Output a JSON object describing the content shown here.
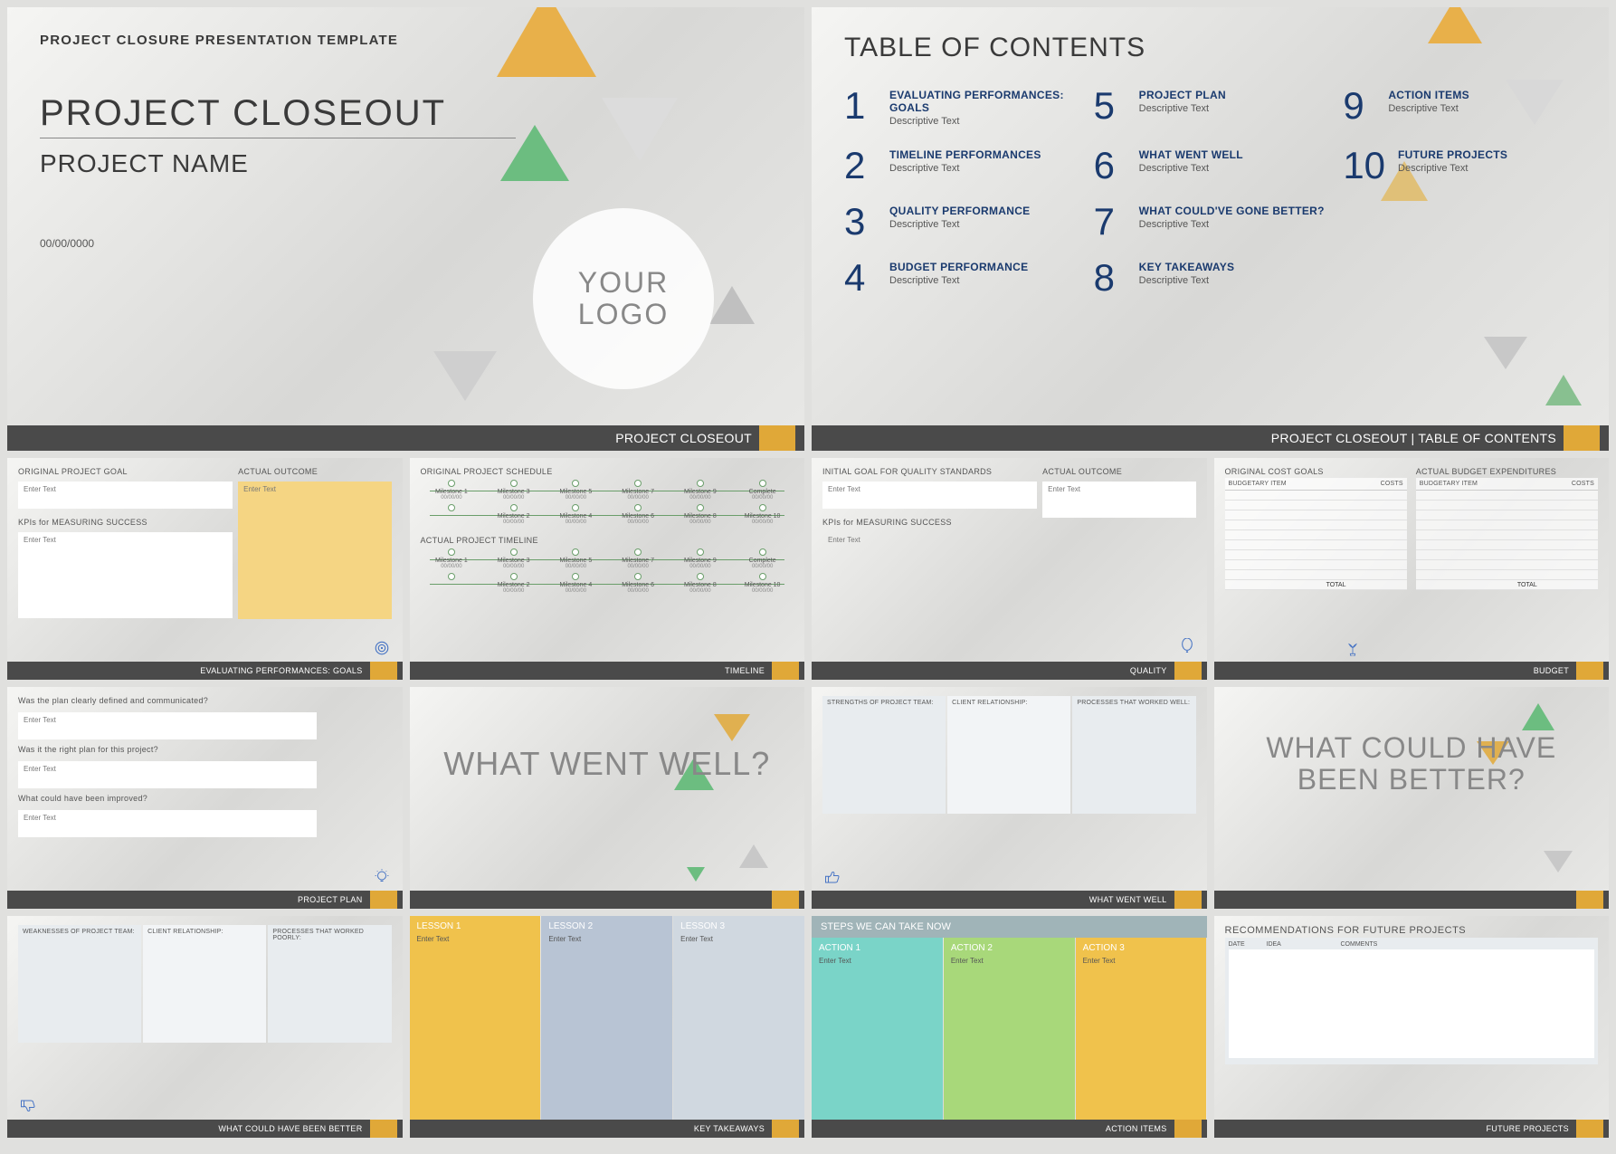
{
  "s1": {
    "header": "PROJECT CLOSURE PRESENTATION TEMPLATE",
    "title": "PROJECT CLOSEOUT",
    "subtitle": "PROJECT NAME",
    "date": "00/00/0000",
    "logo": "YOUR LOGO",
    "footer": "PROJECT CLOSEOUT"
  },
  "s2": {
    "title": "TABLE OF CONTENTS",
    "items": [
      {
        "n": "1",
        "t": "EVALUATING PERFORMANCES: GOALS",
        "d": "Descriptive Text"
      },
      {
        "n": "5",
        "t": "PROJECT PLAN",
        "d": "Descriptive Text"
      },
      {
        "n": "9",
        "t": "ACTION ITEMS",
        "d": "Descriptive Text"
      },
      {
        "n": "2",
        "t": "TIMELINE PERFORMANCES",
        "d": "Descriptive Text"
      },
      {
        "n": "6",
        "t": "WHAT WENT WELL",
        "d": "Descriptive Text"
      },
      {
        "n": "10",
        "t": "FUTURE PROJECTS",
        "d": "Descriptive Text"
      },
      {
        "n": "3",
        "t": "QUALITY PERFORMANCE",
        "d": "Descriptive Text"
      },
      {
        "n": "7",
        "t": "WHAT COULD'VE GONE BETTER?",
        "d": "Descriptive Text"
      },
      {
        "n": "4",
        "t": "BUDGET PERFORMANCE",
        "d": "Descriptive Text"
      },
      {
        "n": "8",
        "t": "KEY TAKEAWAYS",
        "d": "Descriptive Text"
      }
    ],
    "footer": "PROJECT CLOSEOUT    |    TABLE OF CONTENTS"
  },
  "s3": {
    "h1": "ORIGINAL PROJECT GOAL",
    "h2": "ACTUAL OUTCOME",
    "h3": "KPIs for MEASURING SUCCESS",
    "enter": "Enter Text",
    "footer": "EVALUATING PERFORMANCES: GOALS"
  },
  "s4": {
    "h1": "ORIGINAL PROJECT SCHEDULE",
    "h2": "ACTUAL PROJECT TIMELINE",
    "ms": [
      "Milestone 1",
      "Milestone 3",
      "Milestone 5",
      "Milestone 7",
      "Milestone 9",
      "Complete"
    ],
    "ms2": [
      "Milestone 2",
      "Milestone 4",
      "Milestone 6",
      "Milestone 8",
      "Milestone 10"
    ],
    "dt": "00/00/00",
    "footer": "TIMELINE"
  },
  "s5": {
    "h1": "INITIAL GOAL FOR QUALITY STANDARDS",
    "h2": "ACTUAL OUTCOME",
    "h3": "KPIs for MEASURING SUCCESS",
    "enter": "Enter Text",
    "footer": "QUALITY"
  },
  "s6": {
    "h1": "ORIGINAL COST GOALS",
    "h2": "ACTUAL BUDGET EXPENDITURES",
    "c1": "BUDGETARY ITEM",
    "c2": "COSTS",
    "total": "TOTAL",
    "footer": "BUDGET"
  },
  "s7": {
    "q1": "Was the plan clearly defined and communicated?",
    "q2": "Was it the right plan for this project?",
    "q3": "What could have been improved?",
    "enter": "Enter Text",
    "footer": "PROJECT PLAN"
  },
  "s8": {
    "title": "WHAT WENT WELL?"
  },
  "s9": {
    "c1": "STRENGTHS OF PROJECT TEAM:",
    "c2": "CLIENT RELATIONSHIP:",
    "c3": "PROCESSES THAT WORKED WELL:",
    "footer": "WHAT WENT WELL"
  },
  "s10": {
    "title": "WHAT COULD HAVE BEEN BETTER?"
  },
  "s11": {
    "c1": "WEAKNESSES OF PROJECT TEAM:",
    "c2": "CLIENT RELATIONSHIP:",
    "c3": "PROCESSES THAT WORKED POORLY:",
    "footer": "WHAT COULD HAVE BEEN BETTER"
  },
  "s12": {
    "l1": "LESSON 1",
    "l2": "LESSON 2",
    "l3": "LESSON 3",
    "enter": "Enter Text",
    "footer": "KEY TAKEAWAYS"
  },
  "s13": {
    "h": "STEPS WE CAN TAKE NOW",
    "a1": "ACTION 1",
    "a2": "ACTION 2",
    "a3": "ACTION 3",
    "enter": "Enter Text",
    "footer": "ACTION ITEMS"
  },
  "s14": {
    "h": "RECOMMENDATIONS FOR FUTURE PROJECTS",
    "c1": "DATE",
    "c2": "IDEA",
    "c3": "COMMENTS",
    "footer": "FUTURE PROJECTS"
  }
}
